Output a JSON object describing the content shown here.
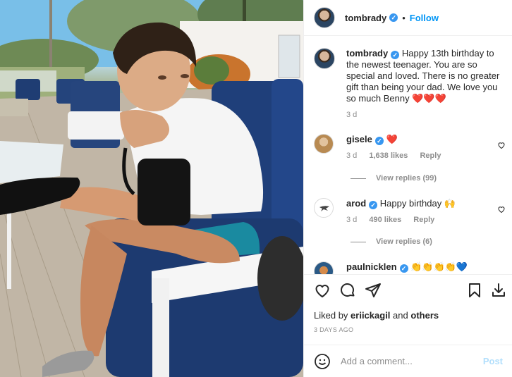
{
  "post": {
    "username": "tombrady",
    "follow_label": "Follow",
    "caption": "Happy 13th birthday to the newest teenager. You are so special and loved. There is no greater gift than being your dad. We love you so much Benny",
    "caption_emoji": "❤️❤️❤️",
    "caption_age": "3 d",
    "liked_by_prefix": "Liked by",
    "liked_by_user": "eriickagil",
    "liked_by_and": "and",
    "liked_by_others": "others",
    "posted_ago": "3 DAYS AGO"
  },
  "comments": [
    {
      "username": "gisele",
      "text": "❤️",
      "age": "3 d",
      "likes": "1,638 likes",
      "reply": "Reply",
      "view_replies": "View replies (99)"
    },
    {
      "username": "arod",
      "text": "Happy birthday 🙌",
      "age": "3 d",
      "likes": "490 likes",
      "reply": "Reply",
      "view_replies": "View replies (6)"
    },
    {
      "username": "paulnicklen",
      "text": "👏👏👏👏💙"
    }
  ],
  "composer": {
    "placeholder": "Add a comment...",
    "post_label": "Post"
  },
  "icons": {
    "verified": "verified-badge-icon",
    "like": "heart-icon",
    "comment": "comment-icon",
    "share": "share-icon",
    "save": "bookmark-icon",
    "download": "download-icon",
    "emoji": "emoji-icon"
  },
  "colors": {
    "accent": "#0095f6",
    "verified": "#3897f0",
    "heart": "#ed4956",
    "muted": "#8e8e8e"
  }
}
